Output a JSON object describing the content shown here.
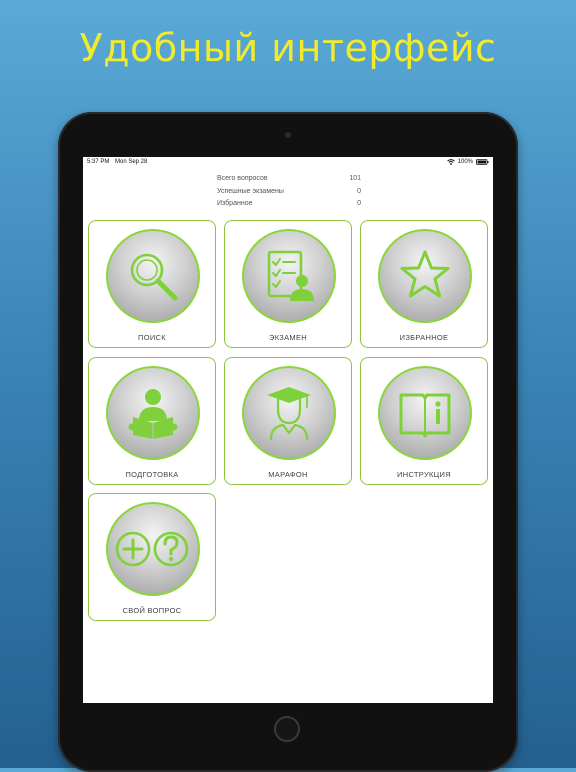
{
  "promo": {
    "title": "Удобный интерфейс"
  },
  "status_bar": {
    "time": "5:37 PM",
    "date": "Mon Sep 28",
    "battery": "100%"
  },
  "stats": [
    {
      "label": "Всего вопросов",
      "value": "101"
    },
    {
      "label": "Успешные экзамены",
      "value": "0"
    },
    {
      "label": "Избранное",
      "value": "0"
    }
  ],
  "menu": {
    "search": "ПОИСК",
    "exam": "ЭКЗАМЕН",
    "favorites": "ИЗБРАННОЕ",
    "preparation": "ПОДГОТОВКА",
    "marathon": "МАРАФОН",
    "instruction": "ИНСТРУКЦИЯ",
    "own_question": "СВОЙ ВОПРОС"
  },
  "colors": {
    "accent": "#8cc63f",
    "icon": "#7fd13b",
    "promo_text": "#f2ea2c"
  }
}
